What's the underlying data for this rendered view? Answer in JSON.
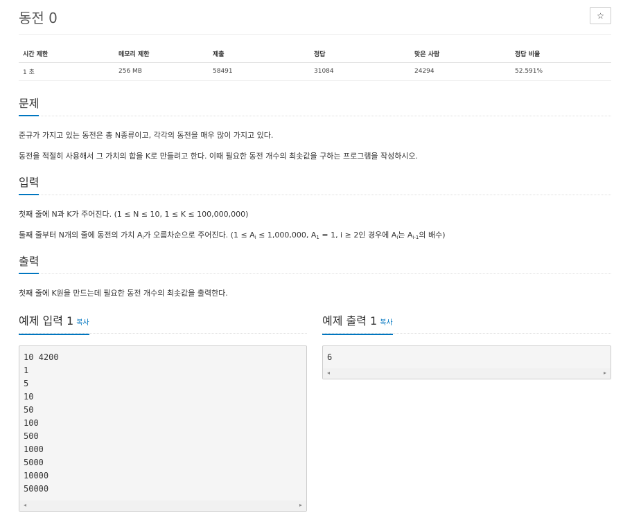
{
  "problem": {
    "title": "동전 0",
    "star_icon": "☆"
  },
  "info_table": {
    "headers": [
      "시간 제한",
      "메모리 제한",
      "제출",
      "정답",
      "맞은 사람",
      "정답 비율"
    ],
    "values": [
      "1 초",
      "256 MB",
      "58491",
      "31084",
      "24294",
      "52.591%"
    ]
  },
  "sections": {
    "problem": {
      "heading": "문제",
      "paragraphs": [
        "준규가 가지고 있는 동전은 총 N종류이고, 각각의 동전을 매우 많이 가지고 있다.",
        "동전을 적절히 사용해서 그 가치의 합을 K로 만들려고 한다. 이때 필요한 동전 개수의 최솟값을 구하는 프로그램을 작성하시오."
      ]
    },
    "input": {
      "heading": "입력",
      "line1": "첫째 줄에 N과 K가 주어진다. (1 ≤ N ≤ 10, 1 ≤ K ≤ 100,000,000)",
      "line2": {
        "p1": "둘째 줄부터 N개의 줄에 동전의 가치 A",
        "s1": "i",
        "p2": "가 오름차순으로 주어진다. (1 ≤ A",
        "s2": "i",
        "p3": " ≤ 1,000,000, A",
        "s3": "1",
        "p4": " = 1, i ≥ 2인 경우에 A",
        "s4": "i",
        "p5": "는 A",
        "s5": "i-1",
        "p6": "의 배수)"
      }
    },
    "output": {
      "heading": "출력",
      "text": "첫째 줄에 K원을 만드는데 필요한 동전 개수의 최솟값을 출력한다."
    }
  },
  "samples": {
    "input": {
      "heading": "예제 입력 1",
      "copy": "복사",
      "text": "10 4200\n1\n5\n10\n50\n100\n500\n1000\n5000\n10000\n50000"
    },
    "output": {
      "heading": "예제 출력 1",
      "copy": "복사",
      "text": "6"
    }
  },
  "scroll_icons": {
    "left": "◂",
    "right": "▸"
  }
}
